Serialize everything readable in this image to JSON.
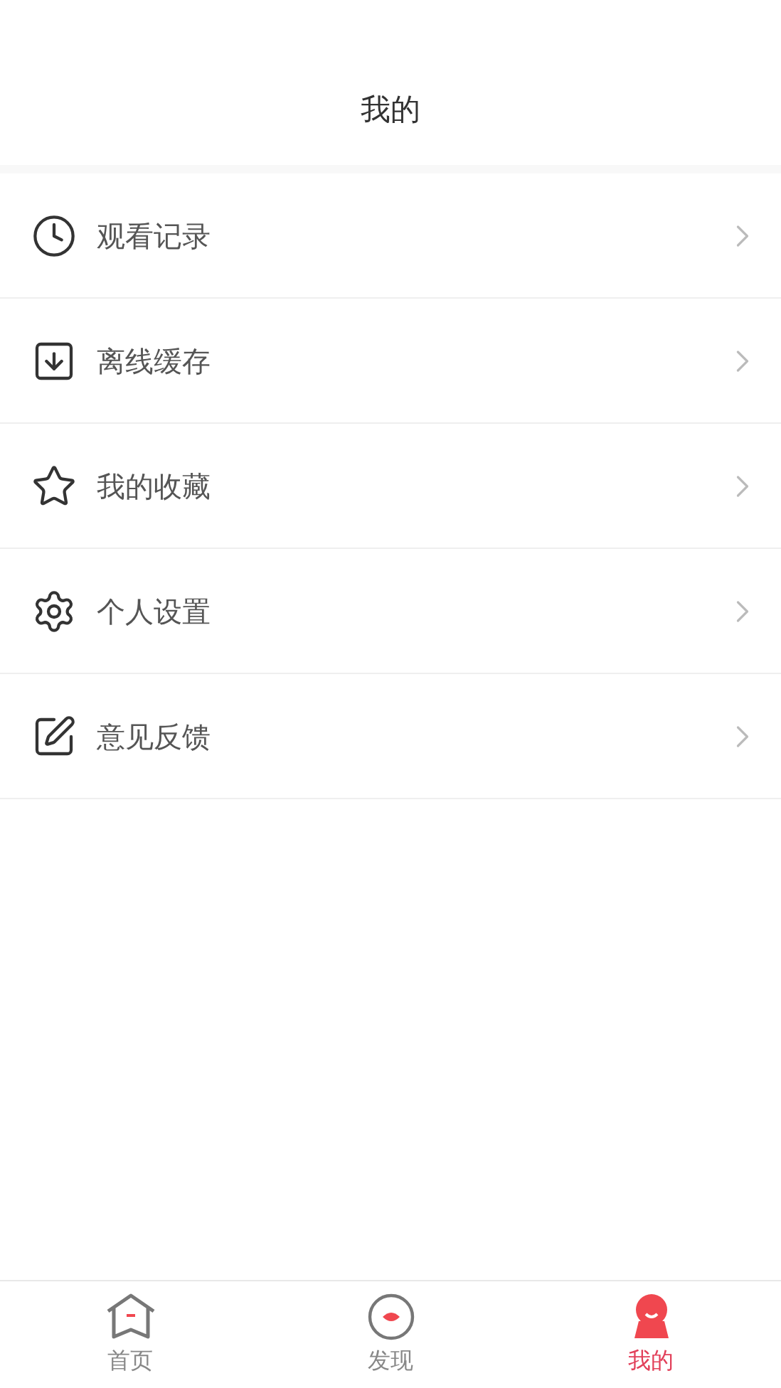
{
  "header": {
    "title": "我的"
  },
  "menu": [
    {
      "kind": "history",
      "label": "观看记录"
    },
    {
      "kind": "download",
      "label": "离线缓存"
    },
    {
      "kind": "favorite",
      "label": "我的收藏"
    },
    {
      "kind": "settings",
      "label": "个人设置"
    },
    {
      "kind": "feedback",
      "label": "意见反馈"
    }
  ],
  "tabs": [
    {
      "kind": "home",
      "label": "首页",
      "selected": false
    },
    {
      "kind": "discover",
      "label": "发现",
      "selected": false
    },
    {
      "kind": "me",
      "label": "我的",
      "selected": true
    }
  ]
}
